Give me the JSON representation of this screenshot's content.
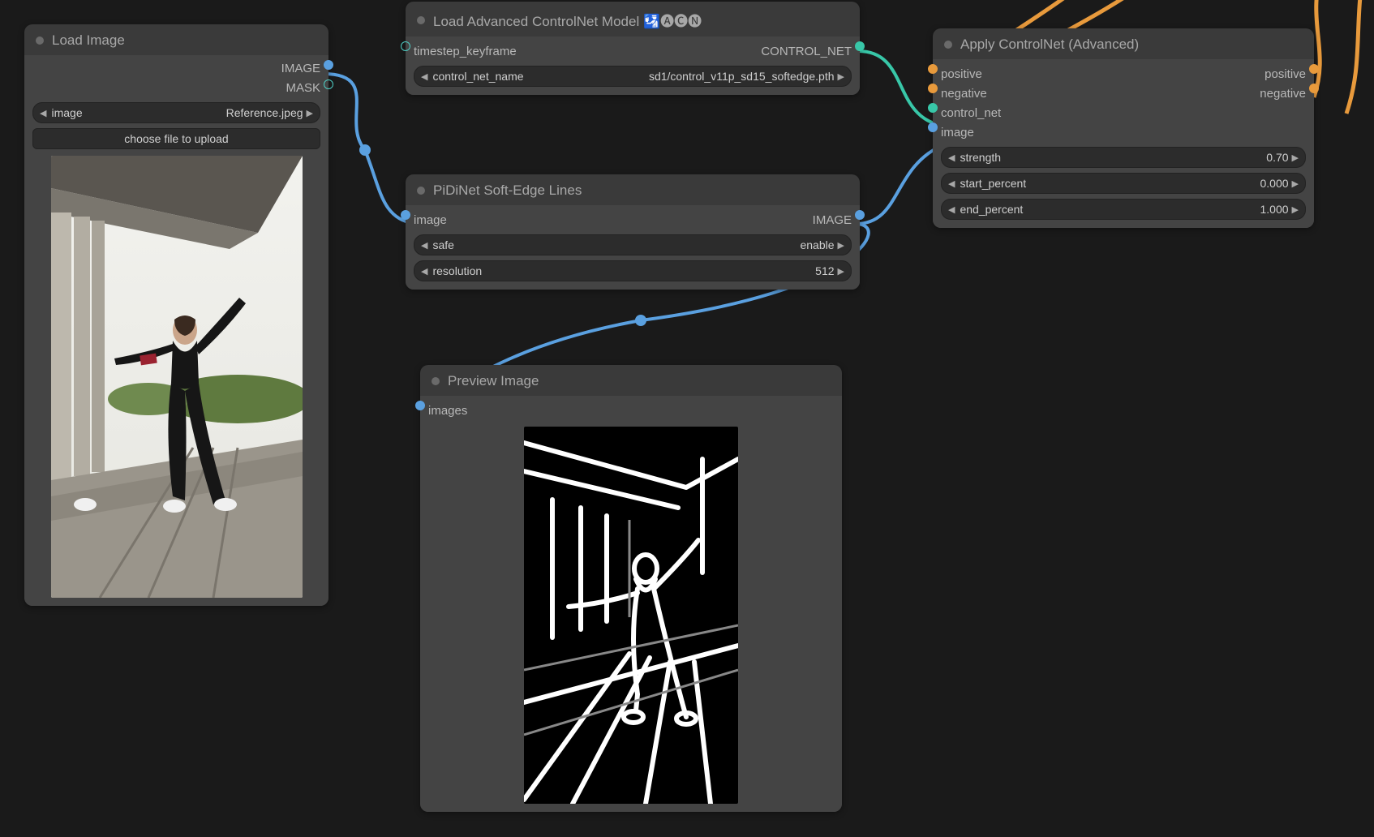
{
  "nodes": {
    "load_image": {
      "title": "Load Image",
      "outputs": {
        "image": "IMAGE",
        "mask": "MASK"
      },
      "widgets": {
        "image_label": "image",
        "image_value": "Reference.jpeg",
        "upload_label": "choose file to upload"
      }
    },
    "load_acn": {
      "title": "Load Advanced ControlNet Model 🛂🅐🅒🅝",
      "inputs": {
        "timestep_keyframe": "timestep_keyframe"
      },
      "outputs": {
        "control_net": "CONTROL_NET"
      },
      "widgets": {
        "cn_name_label": "control_net_name",
        "cn_name_value": "sd1/control_v11p_sd15_softedge.pth"
      }
    },
    "pidinet": {
      "title": "PiDiNet Soft-Edge Lines",
      "inputs": {
        "image": "image"
      },
      "outputs": {
        "image": "IMAGE"
      },
      "widgets": {
        "safe_label": "safe",
        "safe_value": "enable",
        "resolution_label": "resolution",
        "resolution_value": "512"
      }
    },
    "preview": {
      "title": "Preview Image",
      "inputs": {
        "images": "images"
      }
    },
    "apply_cn": {
      "title": "Apply ControlNet (Advanced)",
      "inputs": {
        "positive": "positive",
        "negative": "negative",
        "control_net": "control_net",
        "image": "image"
      },
      "outputs": {
        "positive": "positive",
        "negative": "negative"
      },
      "widgets": {
        "strength_label": "strength",
        "strength_value": "0.70",
        "start_label": "start_percent",
        "start_value": "0.000",
        "end_label": "end_percent",
        "end_value": "1.000"
      }
    }
  }
}
